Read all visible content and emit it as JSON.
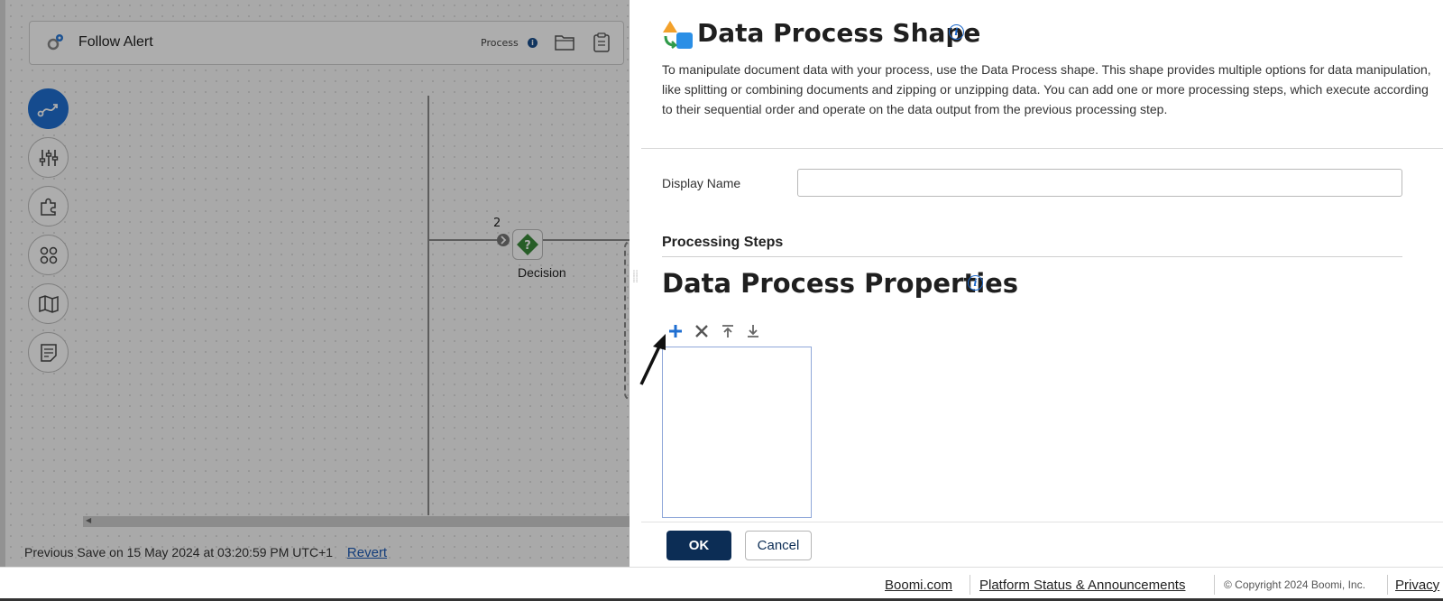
{
  "process": {
    "name": "Follow Alert",
    "type_label": "Process",
    "info_glyph": "i"
  },
  "canvas": {
    "step_number": "2",
    "decision_label": "Decision",
    "decision_glyph": "?",
    "prev_save_text": "Previous Save on 15 May 2024 at 03:20:59 PM UTC+1",
    "revert_label": "Revert"
  },
  "modal": {
    "title": "Data Process Shape",
    "description": "To manipulate document data with your process, use the Data Process shape. This shape provides multiple options for data manipulation, like splitting or combining documents and zipping or unzipping data. You can add one or more processing steps, which execute according to their sequential order and operate on the data output from the previous processing step.",
    "display_name_label": "Display Name",
    "display_name_value": "",
    "processing_steps_heading": "Processing Steps",
    "properties_title": "Data Process Properties",
    "info_glyph": "i",
    "ok_label": "OK",
    "cancel_label": "Cancel"
  },
  "footer": {
    "boomi_link": "Boomi.com",
    "status_link": "Platform Status & Announcements",
    "copyright": "© Copyright 2024 Boomi, Inc.",
    "privacy_link": "Privacy"
  },
  "colors": {
    "primary_dark": "#0c2d55",
    "accent_blue": "#1f6fd1",
    "decision_green": "#3a8a3a"
  },
  "icons": {
    "toolbar": [
      "plus-icon",
      "close-icon",
      "move-top-icon",
      "move-bottom-icon"
    ],
    "sidebar": [
      "route-icon",
      "sliders-icon",
      "puzzle-icon",
      "apps-icon",
      "map-icon",
      "notes-icon"
    ]
  }
}
